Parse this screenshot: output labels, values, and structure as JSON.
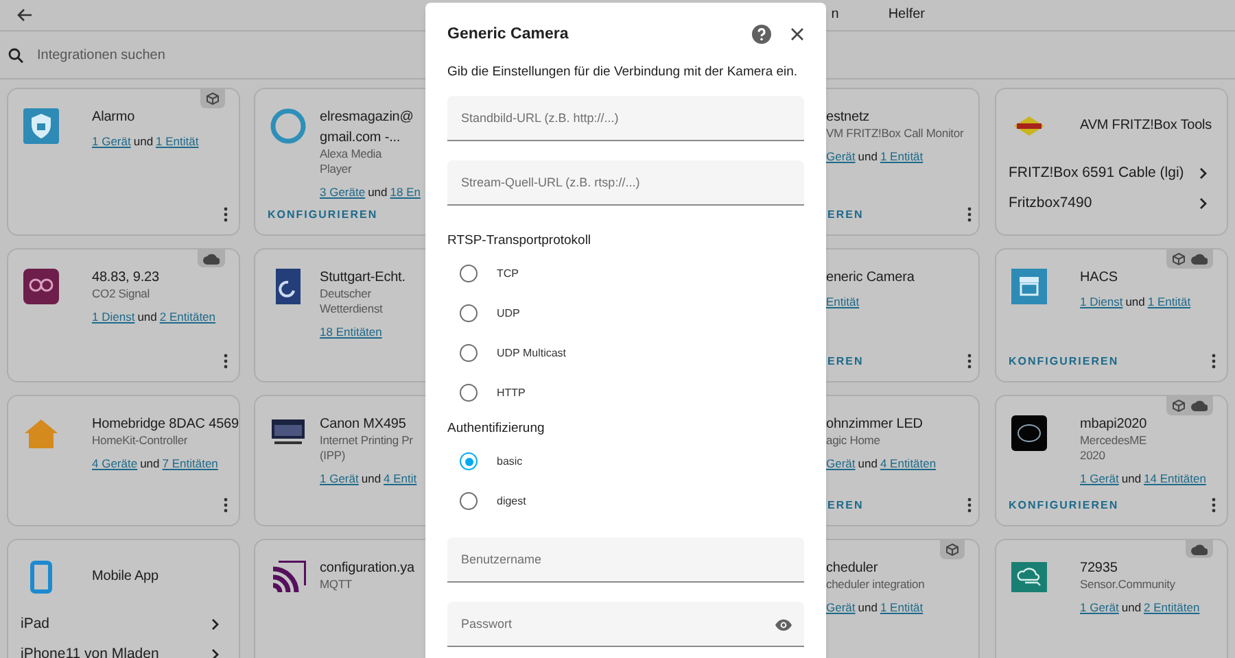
{
  "header": {
    "tabs": [
      {
        "label": "n",
        "selected": false
      },
      {
        "label": "Helfer",
        "selected": false
      }
    ]
  },
  "search": {
    "placeholder": "Integrationen suchen"
  },
  "card_rows": [
    {
      "cards": [
        {
          "title": [
            "Alarmo"
          ],
          "links": [
            {
              "text": "1 Gerät",
              "kind": "link"
            },
            {
              "text": "und",
              "kind": "plain"
            },
            {
              "text": "1 Entität",
              "kind": "link"
            }
          ],
          "custom": true,
          "menu": true
        },
        {
          "title": [
            "elresmagazin@",
            "gmail.com -..."
          ],
          "subtitle": [
            "Alexa Media",
            "Player"
          ],
          "links": [
            {
              "text": "3 Geräte",
              "kind": "link"
            },
            {
              "text": "und",
              "kind": "plain"
            },
            {
              "text": "18 En",
              "kind": "link"
            }
          ],
          "configure": "KONFIGURIEREN"
        },
        {
          "title": [
            "estnetz"
          ],
          "subtitle": [
            "VM FRITZ!Box Call Monitor"
          ],
          "links": [
            {
              "text": "Gerät",
              "kind": "link"
            },
            {
              "text": "und",
              "kind": "plain"
            },
            {
              "text": "1 Entität",
              "kind": "link"
            }
          ],
          "configure": "EREN",
          "menu": true
        },
        {
          "title": [
            "AVM FRITZ!Box Tools"
          ],
          "devices": [
            "FRITZ!Box 6591 Cable (lgi)",
            "Fritzbox7490"
          ]
        }
      ]
    },
    {
      "cards": [
        {
          "title": [
            "48.83, 9.23"
          ],
          "subtitle": [
            "CO2 Signal"
          ],
          "links": [
            {
              "text": "1 Dienst",
              "kind": "link"
            },
            {
              "text": "und",
              "kind": "plain"
            },
            {
              "text": "2 Entitäten",
              "kind": "link"
            }
          ],
          "cloud": true,
          "menu": true
        },
        {
          "title": [
            "Stuttgart-Echt."
          ],
          "subtitle": [
            "Deutscher",
            "Wetterdienst"
          ],
          "links": [
            {
              "text": "18 Entitäten",
              "kind": "link"
            }
          ]
        },
        {
          "title": [
            "eneric Camera"
          ],
          "links": [
            {
              "text": "Entität",
              "kind": "link"
            }
          ],
          "configure": "EREN",
          "menu": true
        },
        {
          "title": [
            "HACS"
          ],
          "links": [
            {
              "text": "1 Dienst",
              "kind": "link"
            },
            {
              "text": "und",
              "kind": "plain"
            },
            {
              "text": "1 Entität",
              "kind": "link"
            }
          ],
          "custom": true,
          "cloud": true,
          "configure": "KONFIGURIEREN",
          "menu": true
        }
      ]
    },
    {
      "cards": [
        {
          "title": [
            "Homebridge 8DAC 4569"
          ],
          "subtitle": [
            "HomeKit-Controller"
          ],
          "links": [
            {
              "text": "4 Geräte",
              "kind": "link"
            },
            {
              "text": "und",
              "kind": "plain"
            },
            {
              "text": "7 Entitäten",
              "kind": "link"
            }
          ],
          "menu": true
        },
        {
          "title": [
            "Canon MX495"
          ],
          "subtitle": [
            "Internet Printing Pr",
            "(IPP)"
          ],
          "links": [
            {
              "text": "1 Gerät",
              "kind": "link"
            },
            {
              "text": "und",
              "kind": "plain"
            },
            {
              "text": "4 Entit",
              "kind": "link"
            }
          ]
        },
        {
          "title": [
            "ohnzimmer LED"
          ],
          "subtitle": [
            "agic Home"
          ],
          "links": [
            {
              "text": "Gerät",
              "kind": "link"
            },
            {
              "text": "und",
              "kind": "plain"
            },
            {
              "text": "4 Entitäten",
              "kind": "link"
            }
          ],
          "configure": "EREN",
          "menu": true
        },
        {
          "title": [
            "mbapi2020"
          ],
          "subtitle": [
            "MercedesME",
            "2020"
          ],
          "links": [
            {
              "text": "1 Gerät",
              "kind": "link"
            },
            {
              "text": "und",
              "kind": "plain"
            },
            {
              "text": "14 Entitäten",
              "kind": "link"
            }
          ],
          "custom": true,
          "cloud": true,
          "configure": "KONFIGURIEREN",
          "menu": true
        }
      ]
    },
    {
      "cards": [
        {
          "title": [
            "Mobile App"
          ],
          "devices": [
            "iPad",
            "iPhone11 von Mladen"
          ]
        },
        {
          "title": [
            "configuration.ya"
          ],
          "subtitle": [
            "MQTT"
          ]
        },
        {
          "title": [
            "cheduler"
          ],
          "subtitle": [
            "cheduler integration"
          ],
          "links": [
            {
              "text": "Gerät",
              "kind": "link"
            },
            {
              "text": "und",
              "kind": "plain"
            },
            {
              "text": "1 Entität",
              "kind": "link"
            }
          ],
          "custom": true
        },
        {
          "title": [
            "72935"
          ],
          "subtitle": [
            "Sensor.Community"
          ],
          "links": [
            {
              "text": "1 Gerät",
              "kind": "link"
            },
            {
              "text": "und",
              "kind": "plain"
            },
            {
              "text": "2 Entitäten",
              "kind": "link"
            }
          ],
          "cloud": true
        }
      ]
    }
  ],
  "dialog": {
    "title": "Generic Camera",
    "description": "Gib die Einstellungen für die Verbindung mit der Kamera ein.",
    "url_fields": [
      {
        "placeholder": "Standbild-URL (z.B. http://...)"
      },
      {
        "placeholder": "Stream-Quell-URL (z.B. rtsp://...)"
      }
    ],
    "transport": {
      "label": "RTSP-Transportprotokoll",
      "options": [
        {
          "label": "TCP",
          "selected": false
        },
        {
          "label": "UDP",
          "selected": false
        },
        {
          "label": "UDP Multicast",
          "selected": false
        },
        {
          "label": "HTTP",
          "selected": false
        }
      ]
    },
    "authentication": {
      "label": "Authentifizierung",
      "options": [
        {
          "label": "basic",
          "selected": true
        },
        {
          "label": "digest",
          "selected": false
        }
      ]
    },
    "credential_fields": [
      {
        "placeholder": "Benutzername",
        "kind": "text"
      },
      {
        "placeholder": "Passwort",
        "kind": "password"
      }
    ]
  }
}
